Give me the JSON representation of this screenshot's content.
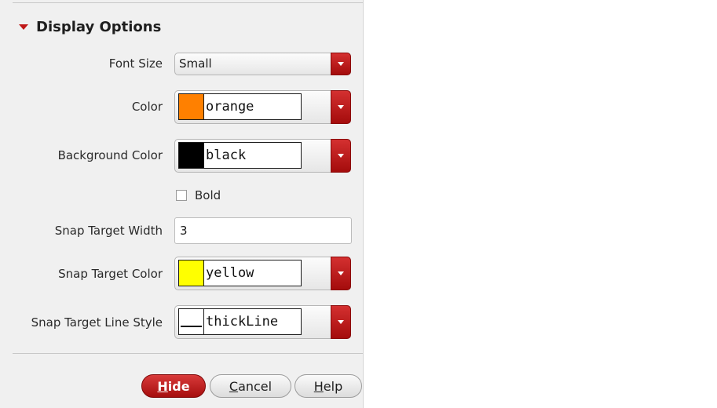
{
  "section": {
    "title": "Display Options"
  },
  "fields": {
    "font_size": {
      "label": "Font Size",
      "value": "Small"
    },
    "color": {
      "label": "Color",
      "value": "orange",
      "swatch": "#ff8000"
    },
    "background_color": {
      "label": "Background Color",
      "value": "black",
      "swatch": "#000000"
    },
    "bold": {
      "label": "Bold",
      "checked": false
    },
    "snap_target_width": {
      "label": "Snap Target Width",
      "value": "3"
    },
    "snap_target_color": {
      "label": "Snap Target Color",
      "value": "yellow",
      "swatch": "#ffff00"
    },
    "snap_target_line_style": {
      "label": "Snap Target Line Style",
      "value": "thickLine"
    }
  },
  "buttons": {
    "hide": {
      "mnemonic": "H",
      "rest": "ide"
    },
    "cancel": {
      "mnemonic": "C",
      "rest": "ancel"
    },
    "help": {
      "mnemonic": "H",
      "rest": "elp"
    }
  },
  "colors": {
    "accent": "#c01818"
  }
}
